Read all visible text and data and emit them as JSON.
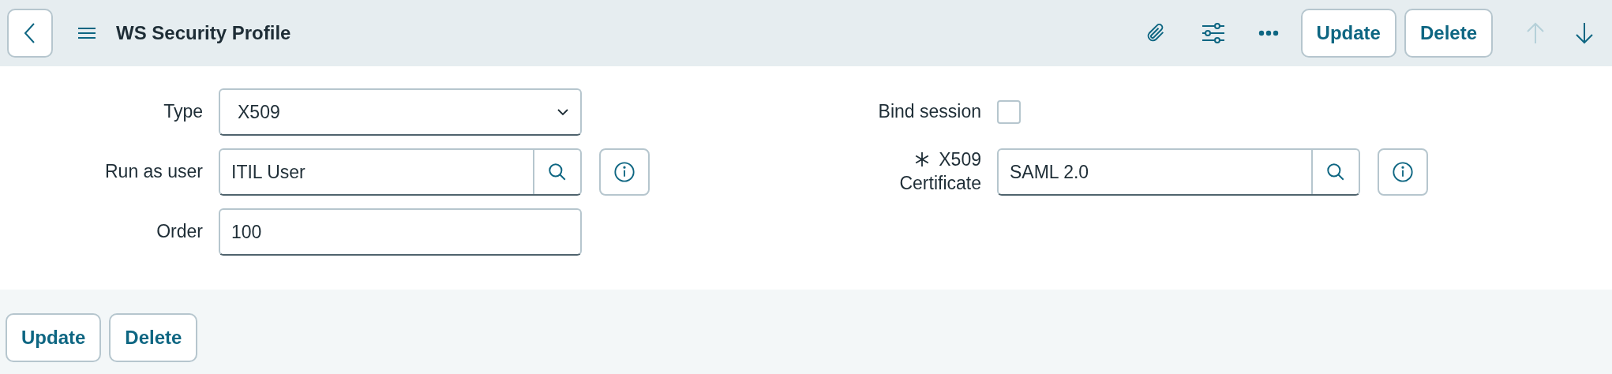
{
  "header": {
    "title": "WS Security Profile",
    "buttons": [
      "Update",
      "Delete"
    ],
    "nav": [
      {
        "kind": "up",
        "disabled": true
      },
      {
        "kind": "down",
        "disabled": false
      }
    ]
  },
  "form": {
    "left": [
      {
        "kind": "select",
        "label": "Type",
        "value": "X509"
      },
      {
        "kind": "reference",
        "label": "Run as user",
        "value": "ITIL User",
        "required": false
      },
      {
        "kind": "text",
        "label": "Order",
        "value": "100"
      }
    ],
    "right": [
      {
        "kind": "checkbox",
        "label": "Bind session",
        "checked": false
      },
      {
        "kind": "reference",
        "label": "X509 Certificate",
        "value": "SAML 2.0",
        "required": true
      }
    ]
  },
  "footer_buttons": [
    "Update",
    "Delete"
  ]
}
